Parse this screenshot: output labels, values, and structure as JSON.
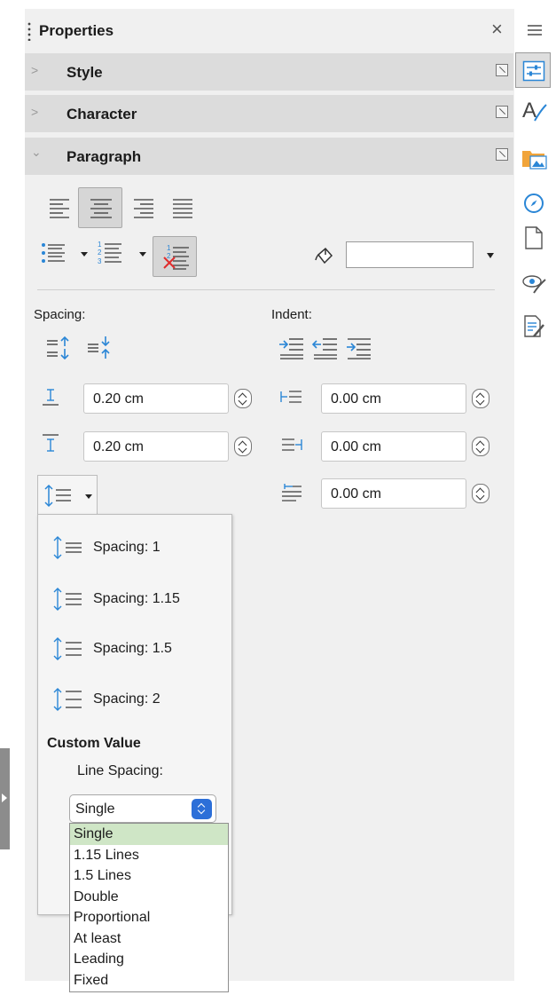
{
  "deck": {
    "title": "Properties",
    "sections": [
      {
        "label": "Style",
        "expanded": false
      },
      {
        "label": "Character",
        "expanded": false
      },
      {
        "label": "Paragraph",
        "expanded": true
      }
    ]
  },
  "paragraph": {
    "alignment": [
      "align-left",
      "align-center",
      "align-right",
      "justify"
    ],
    "alignment_active": "align-center",
    "lists": [
      "unordered-list",
      "ordered-list",
      "outline-format"
    ],
    "highlight_color_value": "",
    "spacing_label": "Spacing:",
    "indent_label": "Indent:",
    "above_value": "0.20 cm",
    "below_value": "0.20 cm",
    "before_text_value": "0.00 cm",
    "after_text_value": "0.00 cm",
    "first_line_value": "0.00 cm"
  },
  "line_spacing_popup": {
    "presets": [
      "Spacing: 1",
      "Spacing: 1.15",
      "Spacing: 1.5",
      "Spacing: 2"
    ],
    "custom_label": "Custom Value",
    "line_spacing_label": "Line Spacing:",
    "selected": "Single",
    "options": [
      "Single",
      "1.15 Lines",
      "1.5 Lines",
      "Double",
      "Proportional",
      "At least",
      "Leading",
      "Fixed"
    ]
  },
  "sidebar_tabs": [
    "properties-icon",
    "styles-icon",
    "gallery-icon",
    "navigator-icon",
    "page-icon",
    "style-inspector-icon",
    "manage-changes-icon"
  ],
  "colors": {
    "accent": "#2c6fd8",
    "icon_blue": "#2a86d6",
    "selected_option": "#cfe6c6",
    "section_bg": "#dcdcdc"
  }
}
